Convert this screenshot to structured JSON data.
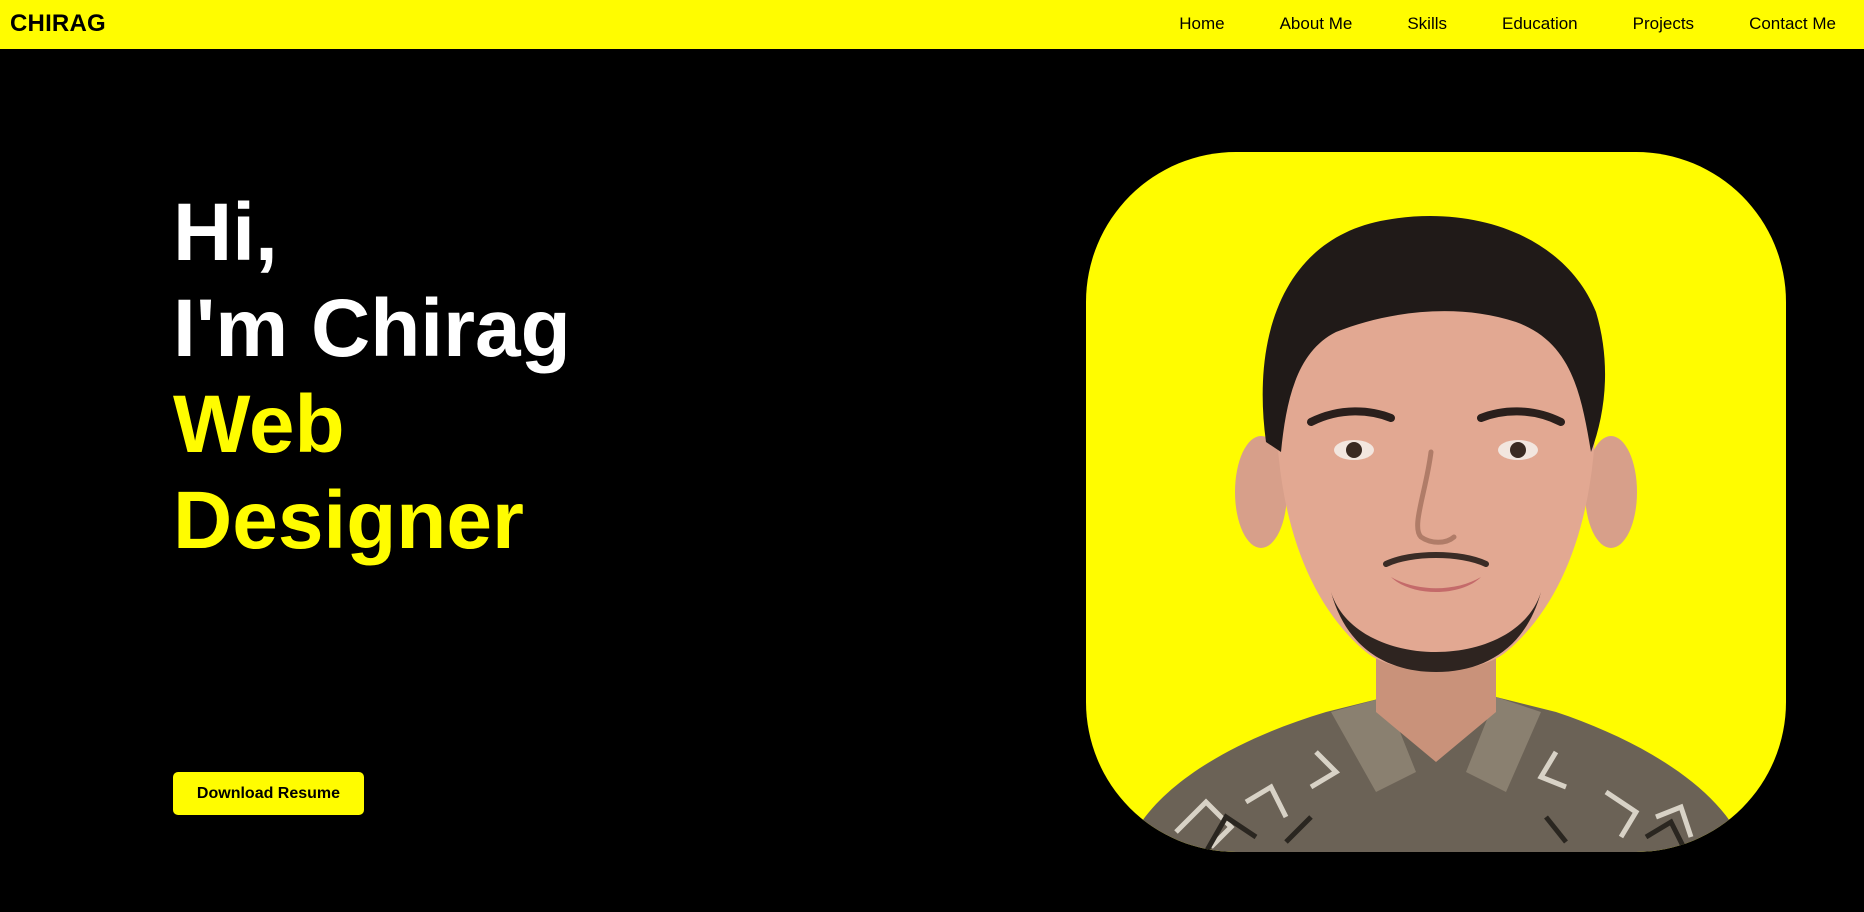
{
  "navbar": {
    "brand": "CHIRAG",
    "links": [
      "Home",
      "About Me",
      "Skills",
      "Education",
      "Projects",
      "Contact Me"
    ]
  },
  "hero": {
    "greeting": "Hi,",
    "intro": "I'm Chirag",
    "role_line1": "Web",
    "role_line2": "Designer",
    "button_label": "Download Resume"
  },
  "colors": {
    "accent": "#fffc00",
    "background": "#000000",
    "text": "#ffffff"
  },
  "icons": {
    "portrait": "person-portrait-photo"
  }
}
